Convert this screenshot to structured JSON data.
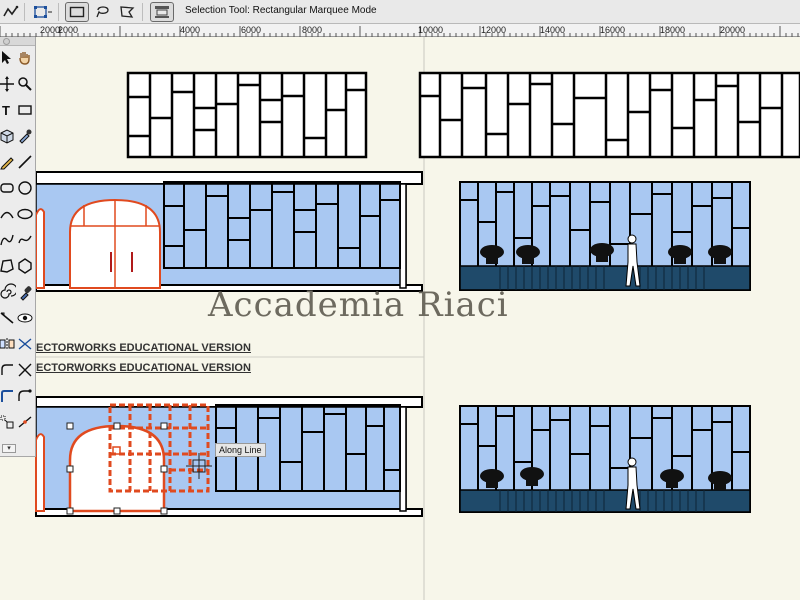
{
  "mode_bar": {
    "status_text": "Selection Tool: Rectangular Marquee Mode",
    "modes": [
      {
        "name": "zigzag-mode-icon"
      },
      {
        "name": "transform-mode-icon"
      },
      {
        "name": "rectangular-marquee-icon",
        "selected": true
      },
      {
        "name": "lasso-marquee-icon"
      },
      {
        "name": "polygon-marquee-icon"
      },
      {
        "name": "align-settings-icon"
      }
    ]
  },
  "ruler": {
    "labels": [
      "2000",
      "2000",
      "4000",
      "6000",
      "8000",
      "10000",
      "12000",
      "14000",
      "16000",
      "18000",
      "20000"
    ]
  },
  "canvas": {
    "watermark": "Accademia Riaci",
    "edu_labels": [
      "ECTORWORKS EDUCATIONAL VERSION",
      "ECTORWORKS EDUCATIONAL VERSION"
    ],
    "tooltip": "Along Line",
    "colors": {
      "glass": "#a9c8f2",
      "frame": "#000000",
      "selection": "#e04a1f",
      "base": "#1f4a6a",
      "paper": "#f7f6ea"
    }
  },
  "tool_palette": {
    "footer_glyph": "▾",
    "tools": [
      "selection-arrow-icon",
      "pan-hand-icon",
      "move-cursor-icon",
      "zoom-icon",
      "text-tool-icon",
      "rectangle-tool-icon",
      "3d-tool-icon",
      "eyedropper-icon",
      "pencil-icon",
      "line-tool-icon",
      "rounded-rect-icon",
      "circle-tool-icon",
      "arc-tool-icon",
      "oval-tool-icon",
      "polyline-tool-icon",
      "freehand-icon",
      "polygon-tool-icon",
      "regular-polygon-icon",
      "spiral-icon",
      "dropper-icon",
      "wall-tool-icon",
      "visibility-icon",
      "mirror-tool-icon",
      "offset-tool-icon",
      "fillet-tool-icon",
      "trim-tool-icon",
      "clip-tool-icon",
      "connect-tool-icon",
      "reshape-tool-icon",
      "split-tool-icon"
    ]
  }
}
